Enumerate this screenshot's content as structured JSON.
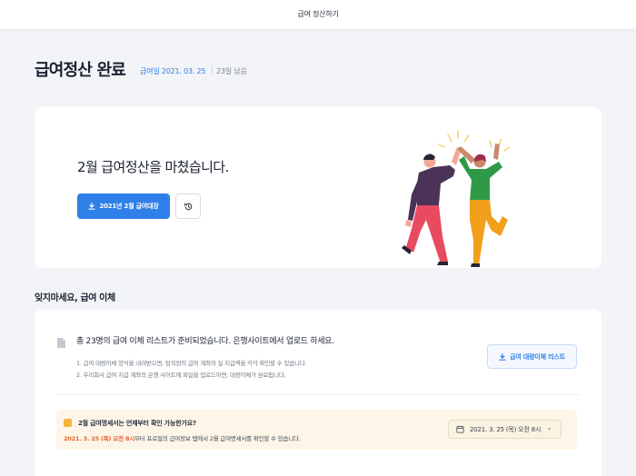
{
  "topbar": {
    "title": "급여 정산하기"
  },
  "header": {
    "title": "급여정산 완료",
    "pay_date": "급여일 2021. 03. 25",
    "days_left": "23일 남음"
  },
  "hero": {
    "message": "2월 급여정산을 마쳤습니다.",
    "download_label": "2021년 2월 급여대장"
  },
  "transfer": {
    "section_title": "잊지마세요, 급여 이체",
    "title": "총 23명의 급여 이체 리스트가 준비되었습니다. 은행사이트에서 업로드 하세요.",
    "lines": [
      "1. 급여 대량이체 양식을 내려받으면, 임직원의 급여 계좌와 실 지급액을 각각 확인할 수 있습니다.",
      "2. 우리회사 급여 지급 계좌의 은행 사이트에 파일을 업로드하면, 대량이체가 완료됩니다."
    ],
    "download_label": "급여 대량이체 리스트"
  },
  "notice": {
    "question": "2월 급여명세서는 언제부터 확인 가능한가요?",
    "highlight": "2021. 3. 25 (목) 오전 8시",
    "rest": "부터 프로필의 급여정보 탭에서 2월 급여명세서를 확인할 수 있습니다.",
    "selected_datetime": "2021. 3. 25 (목) 오전 8시"
  },
  "colors": {
    "accent": "#2f7fe8",
    "highlight": "#e8632e",
    "notice_bg": "#fdf6e8"
  }
}
